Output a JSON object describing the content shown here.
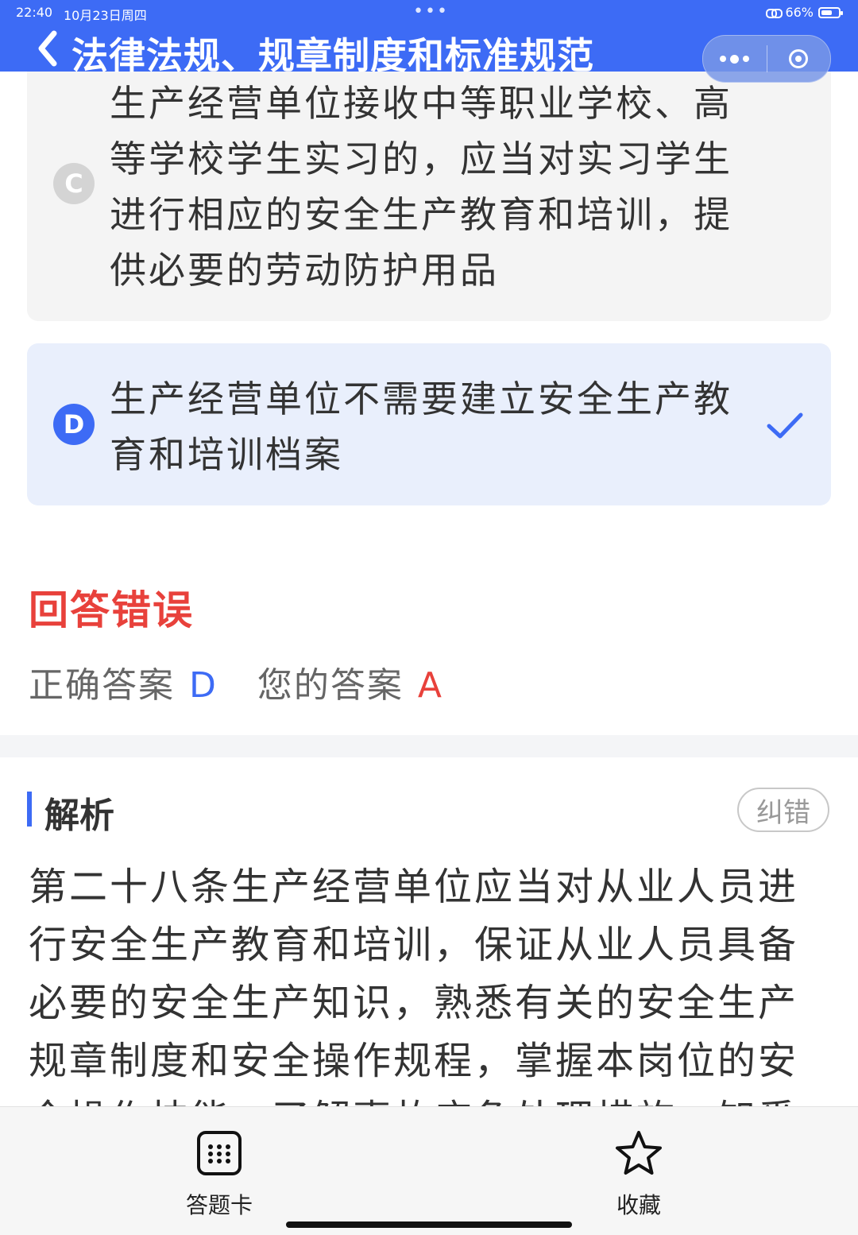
{
  "status_bar": {
    "time": "22:40",
    "date": "10月23日周四",
    "battery": "66%",
    "battery_level": 0.66
  },
  "nav": {
    "title": "法律法规、规章制度和标准规范",
    "more_icon": "more-dots-icon",
    "close_icon": "target-circle-icon"
  },
  "options": {
    "c": {
      "letter": "C",
      "text": "生产经营单位接收中等职业学校、高等学校学生实习的，应当对实习学生进行相应的安全生产教育和培训，提供必要的劳动防护用品"
    },
    "d": {
      "letter": "D",
      "text": "生产经营单位不需要建立安全生产教育和培训档案",
      "selected": true
    }
  },
  "result": {
    "title": "回答错误",
    "correct_label": "正确答案",
    "correct_value": "D",
    "yours_label": "您的答案",
    "yours_value": "A"
  },
  "analysis": {
    "title": "解析",
    "report_label": "纠错",
    "body": "第二十八条生产经营单位应当对从业人员进行安全生产教育和培训，保证从业人员具备必要的安全生产知识，熟悉有关的安全生产规章制度和安全操作规程，掌握本岗位的安全操作技能，了解事故应急处理措施，知悉自身在安全"
  },
  "bottom_bar": {
    "card_label": "答题卡",
    "favorite_label": "收藏"
  },
  "colors": {
    "primary": "#3d6bf5",
    "error": "#e8413b",
    "option_selected_bg": "#e9effc",
    "option_bg": "#f4f4f4"
  }
}
